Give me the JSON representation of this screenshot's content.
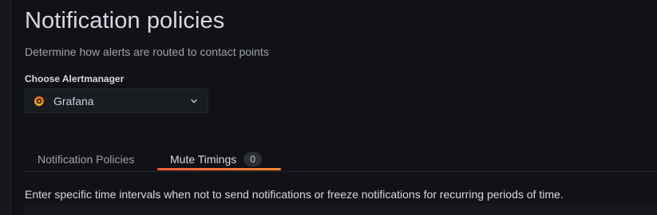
{
  "header": {
    "title": "Notification policies",
    "subtitle": "Determine how alerts are routed to contact points"
  },
  "alertmanager": {
    "label": "Choose Alertmanager",
    "selected": "Grafana",
    "logo_icon": "grafana-logo",
    "chevron_icon": "chevron-down-icon"
  },
  "tabs": [
    {
      "label": "Notification Policies",
      "active": false
    },
    {
      "label": "Mute Timings",
      "active": true,
      "counter": "0"
    }
  ],
  "mute_timings": {
    "description": "Enter specific time intervals when not to send notifications or freeze notifications for recurring periods of time."
  },
  "colors": {
    "background": "#111217",
    "accent_gradient_start": "#f55f3e",
    "accent_gradient_end": "#ff8833"
  }
}
